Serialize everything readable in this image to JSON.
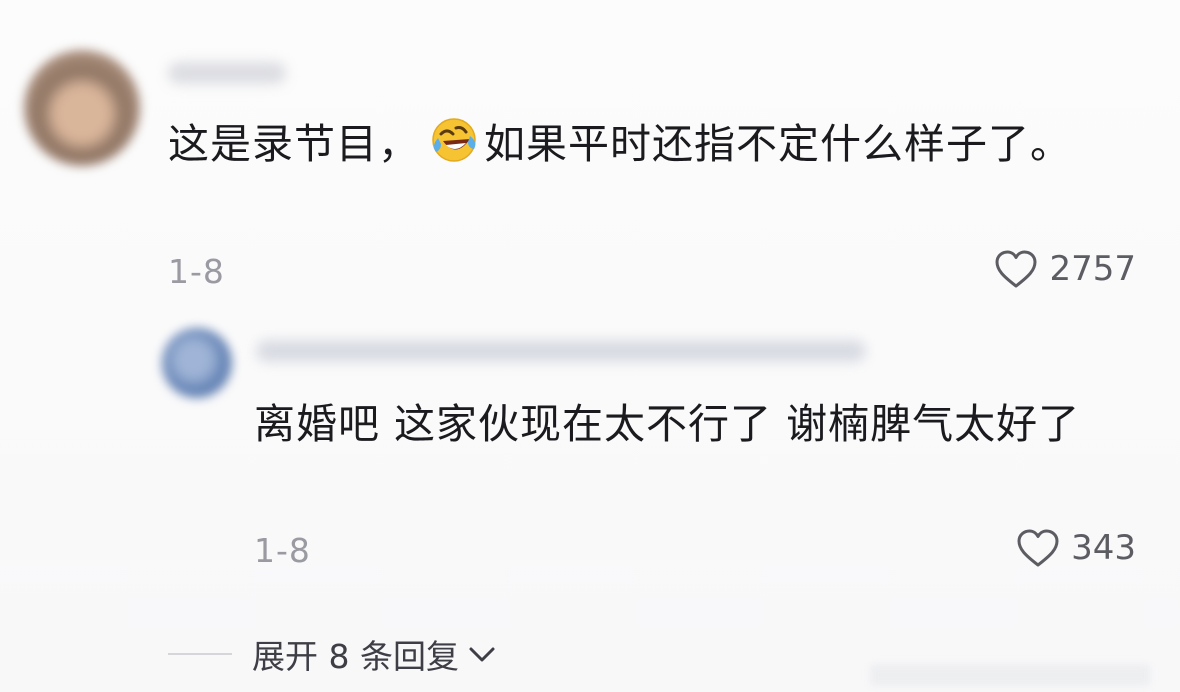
{
  "comment": {
    "text_part1": "这是录节目，",
    "emoji": "rofl-emoji",
    "text_part2": "如果平时还指不定什么样子了。",
    "date": "1-8",
    "likes": "2757"
  },
  "reply": {
    "text": "离婚吧 这家伙现在太不行了 谢楠脾气太好了",
    "date": "1-8",
    "likes": "343"
  },
  "expand": {
    "label": "展开 8 条回复"
  },
  "icons": {
    "like": "heart-outline-icon",
    "expand": "chevron-down-icon"
  }
}
